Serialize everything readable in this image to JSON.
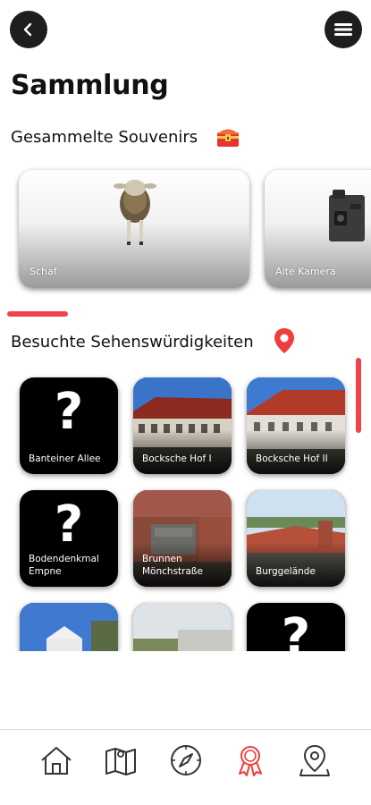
{
  "header": {
    "back_icon": "chevron-left-icon",
    "menu_icon": "hamburger-menu-icon",
    "button_color": "#1e1e1e"
  },
  "page": {
    "title": "Sammlung"
  },
  "souvenirs": {
    "title": "Gesammelte Souvenirs",
    "title_icon": "treasure-chest-icon",
    "items": [
      {
        "label": "Schaf",
        "icon": "sheep-model"
      },
      {
        "label": "Alte Kamera",
        "icon": "camera-model"
      }
    ]
  },
  "sights": {
    "title": "Besuchte Sehenswürdigkeiten",
    "title_icon": "location-pin-icon",
    "items": [
      {
        "label": "Banteiner Allee",
        "visited": false
      },
      {
        "label": "Bocksche Hof I",
        "visited": true
      },
      {
        "label": "Bocksche Hof II",
        "visited": true
      },
      {
        "label": "Bodendenkmal Empne",
        "visited": false
      },
      {
        "label": "Brunnen Mönchstraße",
        "visited": true
      },
      {
        "label": "Burggelände",
        "visited": true
      },
      {
        "label": "",
        "visited": true
      },
      {
        "label": "",
        "visited": true
      },
      {
        "label": "",
        "visited": false
      }
    ]
  },
  "bottom_nav": {
    "items": [
      {
        "icon": "home-icon",
        "active": false
      },
      {
        "icon": "map-icon",
        "active": false
      },
      {
        "icon": "compass-icon",
        "active": false
      },
      {
        "icon": "award-ribbon-icon",
        "active": true
      },
      {
        "icon": "location-pin-outline-icon",
        "active": false
      }
    ]
  },
  "colors": {
    "accent": "#f0444b",
    "dark": "#1e1e1e",
    "inactive_icon": "#333333"
  }
}
